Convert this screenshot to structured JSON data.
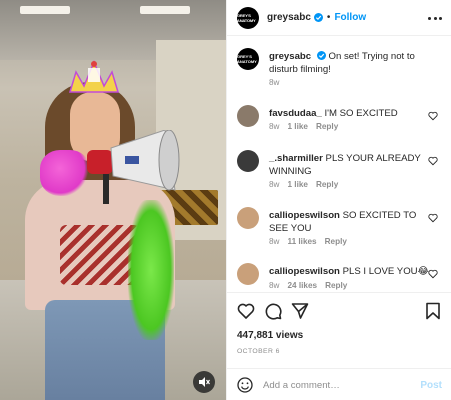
{
  "post": {
    "username": "greysabc",
    "avatar_text": "GREY'S ANATOMY",
    "follow_label": "Follow",
    "dot": "•",
    "caption": "On set! Trying not to disturb filming!",
    "caption_age": "8w",
    "views": "447,881 views",
    "date": "OCTOBER 6"
  },
  "comments": [
    {
      "username": "favsdudaa_",
      "text": "I'M SO EXCITED",
      "age": "8w",
      "likes": "1 like",
      "reply": "Reply",
      "avatar_color": "#8a7a6a"
    },
    {
      "username": "_.sharmiller",
      "text": "PLS YOUR ALREADY WINNING",
      "age": "8w",
      "likes": "1 like",
      "reply": "Reply",
      "avatar_color": "#3a3a3a"
    },
    {
      "username": "calliopeswilson",
      "text": "SO EXCITED TO SEE YOU",
      "age": "8w",
      "likes": "11 likes",
      "reply": "Reply",
      "avatar_color": "#c9a07a"
    },
    {
      "username": "calliopeswilson",
      "text": "PLS I LOVE YOU😂",
      "age": "8w",
      "likes": "24 likes",
      "reply": "Reply",
      "avatar_color": "#c9a07a"
    }
  ],
  "add_comment": {
    "placeholder": "Add a comment…",
    "post_label": "Post"
  },
  "icons": {
    "verified": "verified-badge-icon",
    "more": "more-options-icon",
    "heart": "heart-icon",
    "comment": "comment-icon",
    "share": "share-icon",
    "save": "bookmark-icon",
    "emoji": "emoji-icon",
    "mute": "mute-icon"
  },
  "colors": {
    "accent": "#0095f6",
    "post_disabled": "#b2dffc",
    "muted_text": "#8e8e8e"
  }
}
